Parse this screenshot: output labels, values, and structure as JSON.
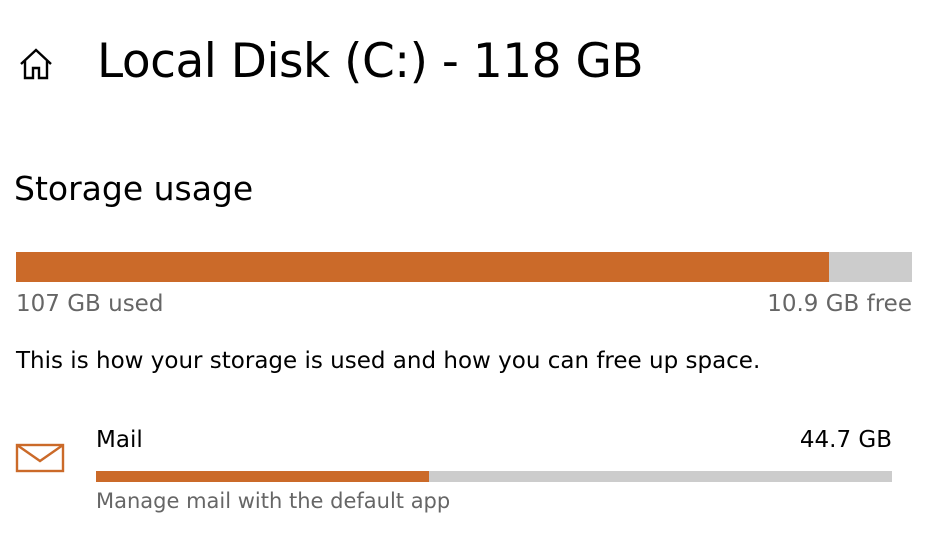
{
  "header": {
    "home_icon": "home-icon",
    "title": "Local Disk (C:) - 118 GB"
  },
  "storage": {
    "heading": "Storage usage",
    "used_label": "107 GB used",
    "free_label": "10.9 GB free",
    "used_fraction": 0.907,
    "description": "This is how your storage is used and how you can free up space."
  },
  "categories": [
    {
      "icon": "mail-icon",
      "name": "Mail",
      "size": "44.7 GB",
      "fraction": 0.418,
      "description": "Manage mail with the default app"
    }
  ],
  "colors": {
    "accent": "#cb6a29",
    "track": "#cccccc",
    "secondary_text": "#666666"
  }
}
